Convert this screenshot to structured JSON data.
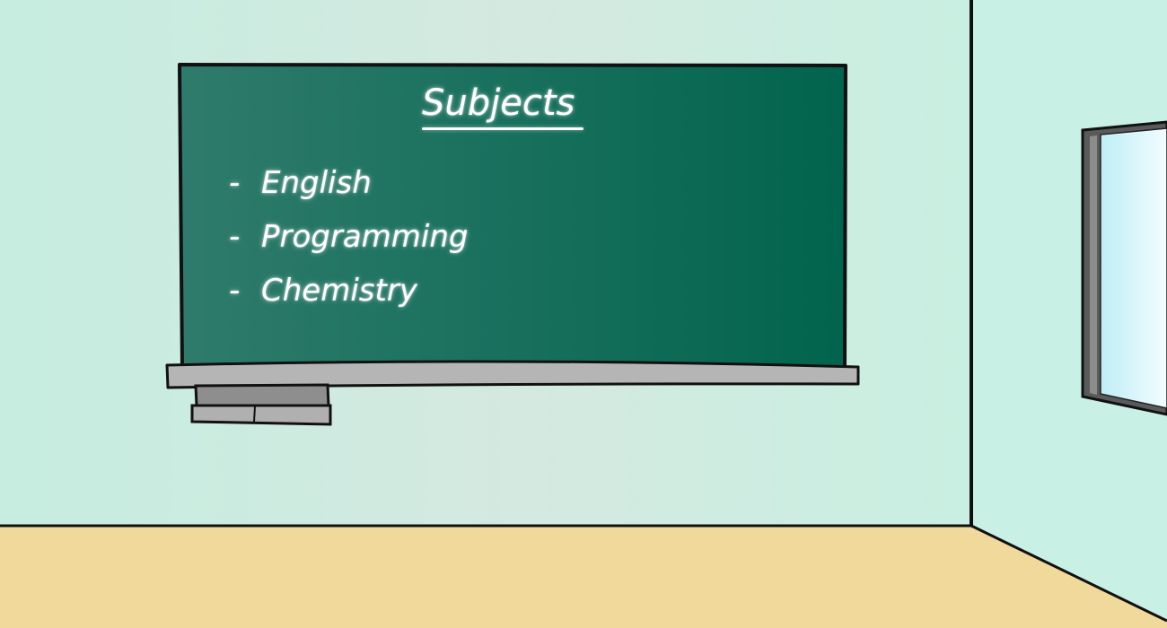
{
  "board": {
    "title": "Subjects",
    "items": [
      {
        "bullet": "-",
        "label": "English"
      },
      {
        "bullet": "-",
        "label": "Programming"
      },
      {
        "bullet": "-",
        "label": "Chemistry"
      }
    ]
  },
  "colors": {
    "wall_left": "#c6ede0",
    "wall_center": "#d4e9e0",
    "wall_right": "#c3f2e2",
    "floor": "#f0d99a",
    "board_light": "#2f7b6c",
    "board_dark": "#01644d",
    "tray": "#b5b5b5",
    "eraser": "#9a9a9a",
    "window_glass": "#dff7fb",
    "outline": "#111111",
    "chalk": "#ffffff"
  }
}
